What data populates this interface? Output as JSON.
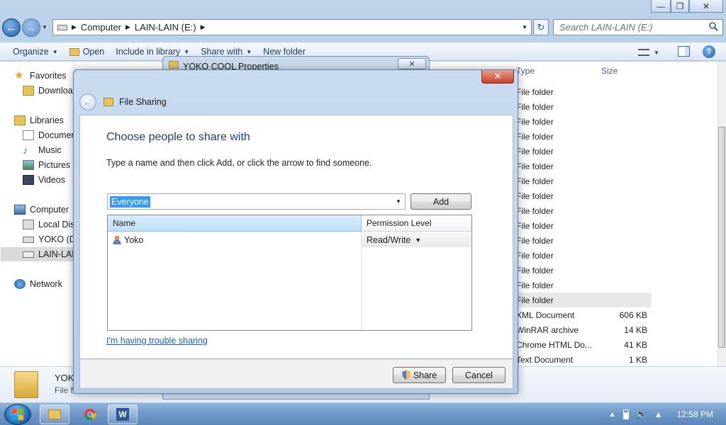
{
  "explorer": {
    "address": {
      "seg1": "Computer",
      "seg2": "LAIN-LAIN (E:)"
    },
    "search_placeholder": "Search LAIN-LAIN (E:)",
    "toolbar": {
      "organize": "Organize",
      "open": "Open",
      "include_library": "Include in library",
      "share_with": "Share with",
      "new_folder": "New folder"
    },
    "nav": {
      "favorites": "Favorites",
      "downloads": "Download",
      "libraries": "Libraries",
      "documents": "Documen",
      "music": "Music",
      "pictures": "Pictures",
      "videos": "Videos",
      "computer": "Computer",
      "local_disk": "Local Disk",
      "yoko_drive": "YOKO (D:)",
      "lain_drive": "LAIN-LAIN",
      "network": "Network"
    },
    "columns": {
      "type": "Type",
      "size": "Size"
    },
    "rows": [
      {
        "type": "File folder",
        "size": ""
      },
      {
        "type": "File folder",
        "size": ""
      },
      {
        "type": "File folder",
        "size": ""
      },
      {
        "type": "File folder",
        "size": ""
      },
      {
        "type": "File folder",
        "size": ""
      },
      {
        "type": "File folder",
        "size": ""
      },
      {
        "type": "File folder",
        "size": ""
      },
      {
        "type": "File folder",
        "size": ""
      },
      {
        "type": "File folder",
        "size": ""
      },
      {
        "type": "File folder",
        "size": ""
      },
      {
        "type": "File folder",
        "size": ""
      },
      {
        "type": "File folder",
        "size": ""
      },
      {
        "type": "File folder",
        "size": ""
      },
      {
        "type": "File folder",
        "size": ""
      },
      {
        "type": "File folder",
        "size": ""
      },
      {
        "type": "XML Document",
        "size": "606 KB"
      },
      {
        "type": "WinRAR archive",
        "size": "14 KB"
      },
      {
        "type": "Chrome HTML Do...",
        "size": "41 KB"
      },
      {
        "type": "Text Document",
        "size": "1 KB"
      }
    ],
    "details": {
      "name": "YOK",
      "kind": "File f"
    }
  },
  "props_dialog": {
    "title": "YOKO COOL Properties"
  },
  "share_dialog": {
    "header_title": "File Sharing",
    "heading": "Choose people to share with",
    "instructions": "Type a name and then click Add, or click the arrow to find someone.",
    "input_value": "Everyone",
    "add_label": "Add",
    "col_name": "Name",
    "col_permission": "Permission Level",
    "user_name": "Yoko",
    "user_permission": "Read/Write",
    "trouble_link": "I'm having trouble sharing",
    "share_label": "Share",
    "cancel_label": "Cancel"
  },
  "taskbar": {
    "clock": "12:58 PM"
  }
}
